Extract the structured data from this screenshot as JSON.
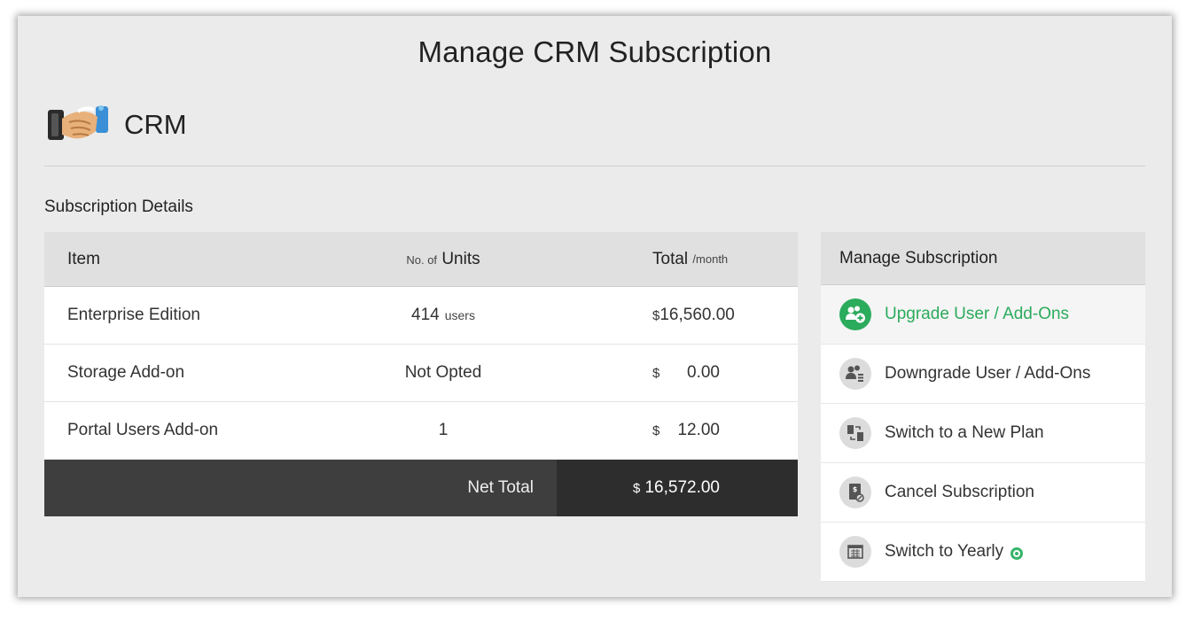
{
  "page": {
    "title": "Manage CRM Subscription"
  },
  "product": {
    "name": "CRM",
    "logo_icon": "handshake-icon"
  },
  "subscription": {
    "section_title": "Subscription Details",
    "columns": {
      "item": "Item",
      "units_prefix": "No. of",
      "units": "Units",
      "total": "Total",
      "total_suffix": "/month"
    },
    "rows": [
      {
        "item": "Enterprise Edition",
        "units": "414",
        "units_suffix": "users",
        "currency": "$",
        "amount": "16,560.00"
      },
      {
        "item": "Storage Add-on",
        "units": "Not Opted",
        "units_suffix": "",
        "currency": "$",
        "amount": "0.00"
      },
      {
        "item": "Portal Users Add-on",
        "units": "1",
        "units_suffix": "",
        "currency": "$",
        "amount": "12.00"
      }
    ],
    "net_total": {
      "label": "Net Total",
      "currency": "$",
      "amount": "16,572.00"
    }
  },
  "manage": {
    "title": "Manage Subscription",
    "items": [
      {
        "label": "Upgrade User / Add-Ons",
        "icon": "upgrade-users-icon",
        "active": true
      },
      {
        "label": "Downgrade User / Add-Ons",
        "icon": "downgrade-users-icon",
        "active": false
      },
      {
        "label": "Switch to a New Plan",
        "icon": "switch-plan-icon",
        "active": false
      },
      {
        "label": "Cancel Subscription",
        "icon": "cancel-subscription-icon",
        "active": false
      },
      {
        "label": "Switch to Yearly",
        "icon": "calendar-icon",
        "active": false,
        "badge_icon": "discount-badge-icon"
      }
    ]
  },
  "colors": {
    "accent_green": "#2bab5c",
    "footer_dark": "#3e3e3e",
    "footer_darker": "#2d2d2d",
    "header_gray": "#e0e0e0"
  }
}
